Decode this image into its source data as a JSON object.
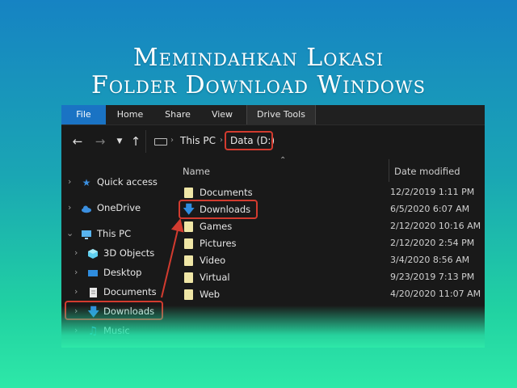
{
  "heading": {
    "line1": "Memindahkan Lokasi",
    "line2": "Folder Download Windows"
  },
  "ribbon": {
    "tabs": [
      "File",
      "Home",
      "Share",
      "View",
      "Drive Tools"
    ]
  },
  "breadcrumb": {
    "this_pc": "This PC",
    "drive": "Data (D:)"
  },
  "nav_pane": {
    "items": [
      {
        "label": "Quick access",
        "icon": "star-icon"
      },
      {
        "label": "OneDrive",
        "icon": "cloud-icon"
      },
      {
        "label": "This PC",
        "icon": "monitor-icon"
      },
      {
        "label": "3D Objects",
        "icon": "cube-icon"
      },
      {
        "label": "Desktop",
        "icon": "desktop-icon"
      },
      {
        "label": "Documents",
        "icon": "document-icon"
      },
      {
        "label": "Downloads",
        "icon": "download-arrow-icon"
      },
      {
        "label": "Music",
        "icon": "music-note-icon"
      }
    ]
  },
  "columns": {
    "name": "Name",
    "date": "Date modified"
  },
  "files": [
    {
      "name": "Documents",
      "date": "12/2/2019 1:11 PM"
    },
    {
      "name": "Downloads",
      "date": "6/5/2020 6:07 AM"
    },
    {
      "name": "Games",
      "date": "2/12/2020 10:16 AM"
    },
    {
      "name": "Pictures",
      "date": "2/12/2020 2:54 PM"
    },
    {
      "name": "Video",
      "date": "3/4/2020 8:56 AM"
    },
    {
      "name": "Virtual",
      "date": "9/23/2019 7:13 PM"
    },
    {
      "name": "Web",
      "date": "4/20/2020 11:07 AM"
    }
  ],
  "colors": {
    "accent": "#1a73c4",
    "highlight": "#d23b2f",
    "folder": "#efe6a6"
  }
}
